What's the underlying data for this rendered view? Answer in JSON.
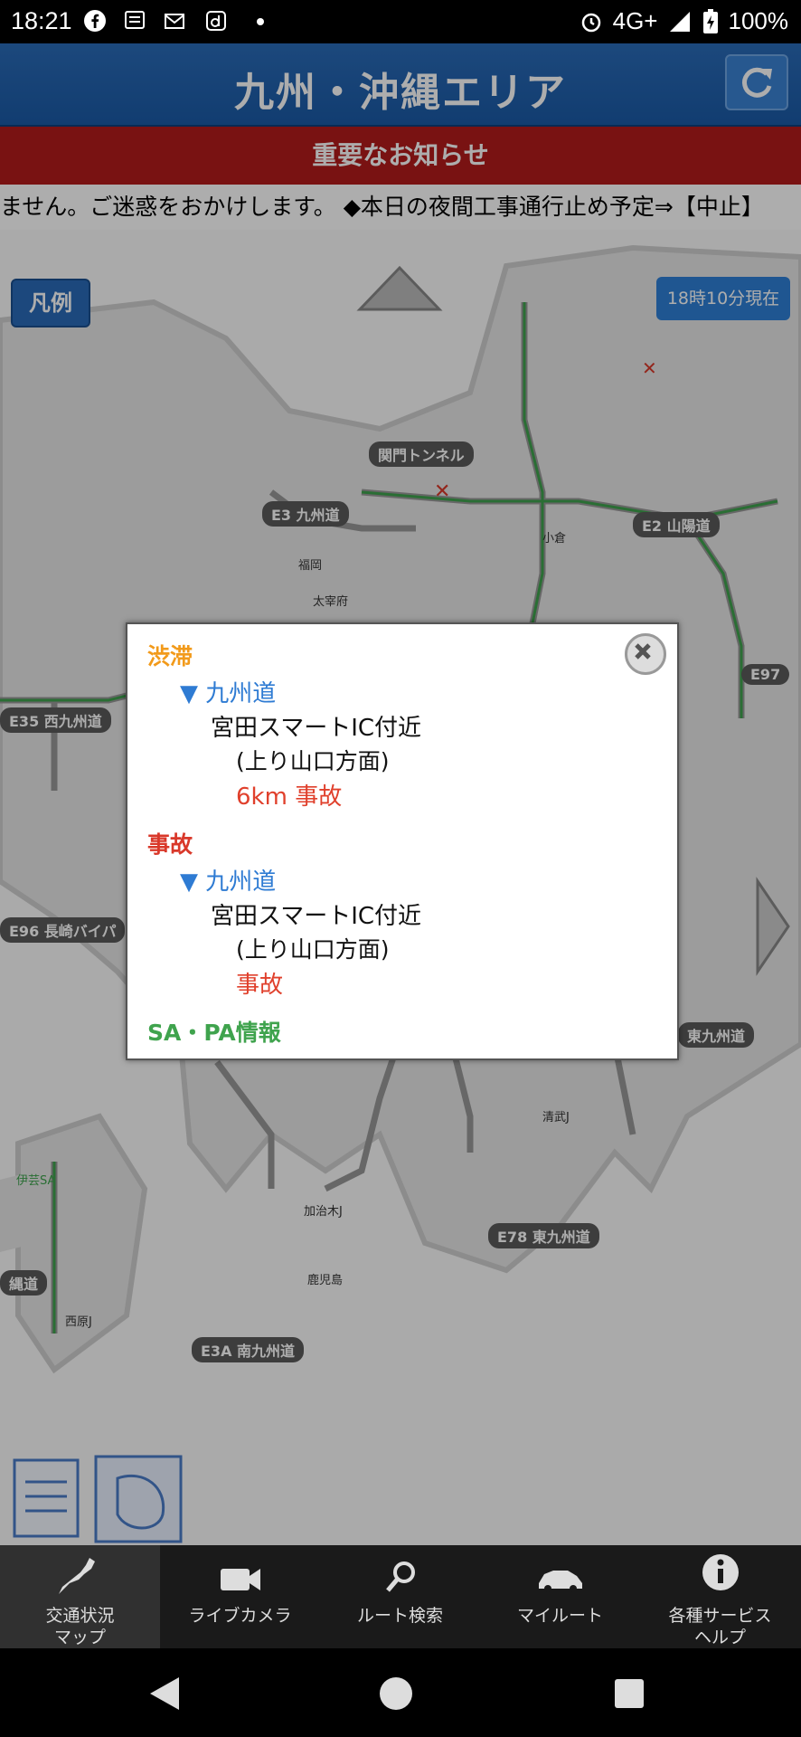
{
  "status_bar": {
    "time": "18:21",
    "network": "4G+",
    "battery": "100%"
  },
  "header": {
    "title": "九州・沖縄エリア"
  },
  "notice": {
    "title": "重要なお知らせ",
    "ticker": "ません。ご迷惑をおかけします。 ◆本日の夜間工事通行止め予定⇒【中止】"
  },
  "map": {
    "legend_label": "凡例",
    "timestamp": "18時10分現在",
    "labels": {
      "kanmon": "関門トンネル",
      "e3": "E3",
      "kyushu_do": "九州道",
      "e2": "E2",
      "sanyo_do": "山陽道",
      "e35": "E35",
      "nishi_kyushu": "西九州道",
      "e96": "E96",
      "nagasaki": "長崎バイパ",
      "e97": "E97",
      "higashi_kyushu": "東九州道",
      "e78": "E78",
      "higashi_kyushu2": "東九州道",
      "e3a": "E3A",
      "minami_kyushu": "南九州道",
      "naha_road": "縄道",
      "fukuoka": "福岡",
      "dazaifu": "太宰府",
      "kokura": "小倉",
      "kagoshima": "鹿児島",
      "nishihara": "西原J",
      "kajiki": "加治木J",
      "miyakonojo": "清武J",
      "ikeda": "伊芸SA"
    }
  },
  "popup": {
    "section1_title": "渋滞",
    "section1_route": "▼ 九州道",
    "section1_location": "宮田スマートIC付近",
    "section1_direction": "(上り山口方面)",
    "section1_detail": "6km 事故",
    "section2_title": "事故",
    "section2_route": "▼ 九州道",
    "section2_location": "宮田スマートIC付近",
    "section2_direction": "(上り山口方面)",
    "section2_detail": "事故",
    "section3_title": "SA・PA情報"
  },
  "bottom_nav": [
    {
      "label_line1": "交通状況",
      "label_line2": "マップ",
      "icon": "japan-map-icon"
    },
    {
      "label_line1": "ライブカメラ",
      "label_line2": "",
      "icon": "video-camera-icon"
    },
    {
      "label_line1": "ルート検索",
      "label_line2": "",
      "icon": "magnifier-icon"
    },
    {
      "label_line1": "マイルート",
      "label_line2": "",
      "icon": "car-icon"
    },
    {
      "label_line1": "各種サービス",
      "label_line2": "ヘルプ",
      "icon": "info-icon"
    }
  ],
  "colors": {
    "header_blue": "#1a5aa6",
    "notice_red": "#b31b1b",
    "jam_orange": "#f29a1a",
    "accident_red": "#d9382a",
    "route_blue": "#2e7bd3",
    "sapa_green": "#3fa34d"
  }
}
